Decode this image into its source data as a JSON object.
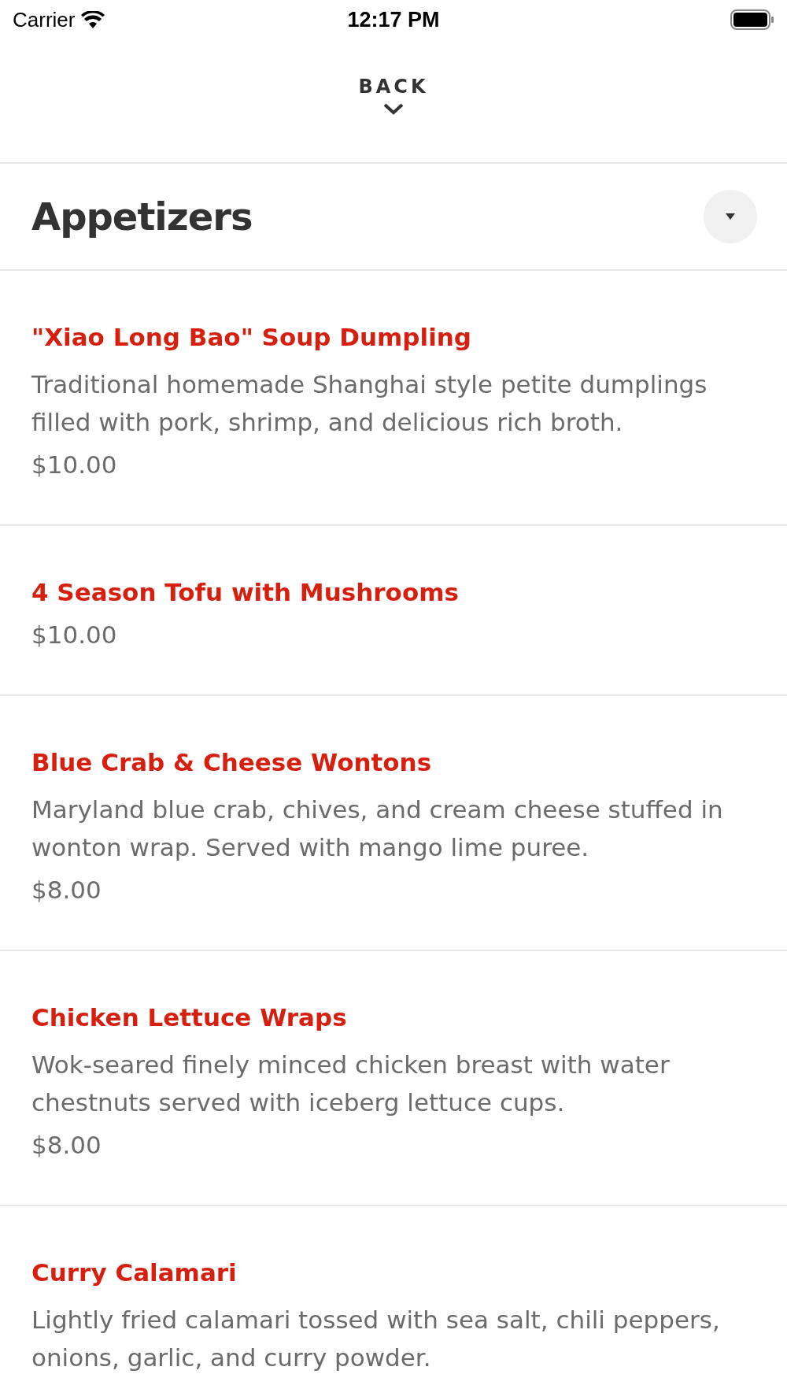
{
  "status_bar": {
    "carrier": "Carrier",
    "time": "12:17 PM"
  },
  "header": {
    "back_label": "BACK"
  },
  "section": {
    "title": "Appetizers",
    "expanded": true
  },
  "items": [
    {
      "name": "\"Xiao Long Bao\" Soup Dumpling",
      "description": "Traditional homemade Shanghai style petite dumplings filled with pork, shrimp, and delicious rich broth.",
      "price": "$10.00"
    },
    {
      "name": "4 Season Tofu with Mushrooms",
      "price": "$10.00"
    },
    {
      "name": "Blue Crab & Cheese Wontons",
      "description": "Maryland blue crab, chives, and cream cheese stuffed in wonton wrap. Served with mango lime puree.",
      "price": "$8.00"
    },
    {
      "name": "Chicken Lettuce Wraps",
      "description": "Wok-seared finely minced chicken breast with water chestnuts served with iceberg lettuce cups.",
      "price": "$8.00"
    },
    {
      "name": "Curry Calamari",
      "description": "Lightly fried calamari tossed with sea salt, chili peppers, onions, garlic, and curry powder."
    }
  ]
}
